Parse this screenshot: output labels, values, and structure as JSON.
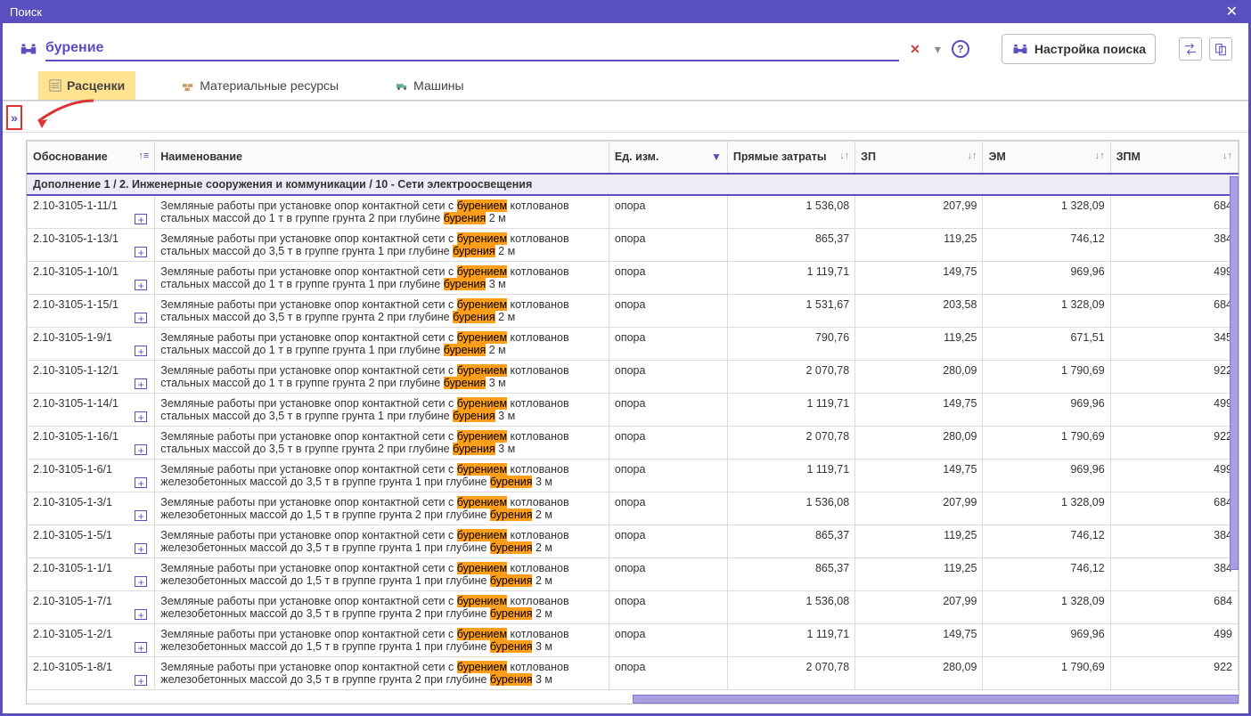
{
  "window": {
    "title": "Поиск"
  },
  "search": {
    "query": "бурение",
    "clear_symbol": "✕",
    "dropdown_symbol": "▾",
    "help_symbol": "?",
    "settings_label": "Настройка поиска"
  },
  "tabs": [
    {
      "label": "Расценки",
      "active": true
    },
    {
      "label": "Материальные ресурсы",
      "active": false
    },
    {
      "label": "Машины",
      "active": false
    }
  ],
  "collapse": {
    "symbol": "»"
  },
  "columns": {
    "code": "Обоснование",
    "name": "Наименование",
    "unit": "Ед. изм.",
    "direct": "Прямые затраты",
    "zp": "ЗП",
    "em": "ЭМ",
    "zpm": "ЗПМ"
  },
  "section": {
    "title": "Дополнение 1 / 2. Инженерные сооружения и коммуникации / 10 - Сети электроосвещения"
  },
  "rows": [
    {
      "code": "2.10-3105-1-11/1",
      "name_pre": "Земляные работы при установке опор контактной сети с ",
      "hl1": "бурением",
      "name_mid": " котлованов стальных массой до 1 т в группе грунта 2 при глубине ",
      "hl2": "бурения",
      "name_post": " 2 м",
      "unit": "опора",
      "direct": "1 536,08",
      "zp": "207,99",
      "em": "1 328,09",
      "zpm": "684"
    },
    {
      "code": "2.10-3105-1-13/1",
      "name_pre": "Земляные работы при установке опор контактной сети с ",
      "hl1": "бурением",
      "name_mid": " котлованов стальных массой до 3,5 т в группе грунта 1 при глубине ",
      "hl2": "бурения",
      "name_post": " 2 м",
      "unit": "опора",
      "direct": "865,37",
      "zp": "119,25",
      "em": "746,12",
      "zpm": "384"
    },
    {
      "code": "2.10-3105-1-10/1",
      "name_pre": "Земляные работы при установке опор контактной сети с ",
      "hl1": "бурением",
      "name_mid": " котлованов стальных массой до 1 т в группе грунта 1 при глубине ",
      "hl2": "бурения",
      "name_post": " 3 м",
      "unit": "опора",
      "direct": "1 119,71",
      "zp": "149,75",
      "em": "969,96",
      "zpm": "499"
    },
    {
      "code": "2.10-3105-1-15/1",
      "name_pre": "Земляные работы при установке опор контактной сети с ",
      "hl1": "бурением",
      "name_mid": " котлованов стальных массой до 3,5 т в группе грунта 2 при глубине ",
      "hl2": "бурения",
      "name_post": " 2 м",
      "unit": "опора",
      "direct": "1 531,67",
      "zp": "203,58",
      "em": "1 328,09",
      "zpm": "684"
    },
    {
      "code": "2.10-3105-1-9/1",
      "name_pre": "Земляные работы при установке опор контактной сети с ",
      "hl1": "бурением",
      "name_mid": " котлованов стальных массой до 1 т в группе грунта 1 при глубине ",
      "hl2": "бурения",
      "name_post": " 2 м",
      "unit": "опора",
      "direct": "790,76",
      "zp": "119,25",
      "em": "671,51",
      "zpm": "345"
    },
    {
      "code": "2.10-3105-1-12/1",
      "name_pre": "Земляные работы при установке опор контактной сети с ",
      "hl1": "бурением",
      "name_mid": " котлованов стальных массой до 1 т в группе грунта 2 при глубине ",
      "hl2": "бурения",
      "name_post": " 3 м",
      "unit": "опора",
      "direct": "2 070,78",
      "zp": "280,09",
      "em": "1 790,69",
      "zpm": "922"
    },
    {
      "code": "2.10-3105-1-14/1",
      "name_pre": "Земляные работы при установке опор контактной сети с ",
      "hl1": "бурением",
      "name_mid": " котлованов стальных массой до 3,5 т в группе грунта 1 при глубине ",
      "hl2": "бурения",
      "name_post": " 3 м",
      "unit": "опора",
      "direct": "1 119,71",
      "zp": "149,75",
      "em": "969,96",
      "zpm": "499"
    },
    {
      "code": "2.10-3105-1-16/1",
      "name_pre": "Земляные работы при установке опор контактной сети с ",
      "hl1": "бурением",
      "name_mid": " котлованов стальных массой до 3,5 т в группе грунта 2 при глубине ",
      "hl2": "бурения",
      "name_post": " 3 м",
      "unit": "опора",
      "direct": "2 070,78",
      "zp": "280,09",
      "em": "1 790,69",
      "zpm": "922"
    },
    {
      "code": "2.10-3105-1-6/1",
      "name_pre": "Земляные работы при установке опор контактной сети с ",
      "hl1": "бурением",
      "name_mid": " котлованов железобетонных массой до 3,5 т в группе грунта 1 при глубине ",
      "hl2": "бурения",
      "name_post": " 3 м",
      "unit": "опора",
      "direct": "1 119,71",
      "zp": "149,75",
      "em": "969,96",
      "zpm": "499"
    },
    {
      "code": "2.10-3105-1-3/1",
      "name_pre": "Земляные работы при установке опор контактной сети с ",
      "hl1": "бурением",
      "name_mid": " котлованов железобетонных массой до 1,5 т в группе грунта 2 при глубине ",
      "hl2": "бурения",
      "name_post": " 2 м",
      "unit": "опора",
      "direct": "1 536,08",
      "zp": "207,99",
      "em": "1 328,09",
      "zpm": "684"
    },
    {
      "code": "2.10-3105-1-5/1",
      "name_pre": "Земляные работы при установке опор контактной сети с ",
      "hl1": "бурением",
      "name_mid": " котлованов железобетонных массой до 3,5 т в группе грунта 1 при глубине ",
      "hl2": "бурения",
      "name_post": " 2 м",
      "unit": "опора",
      "direct": "865,37",
      "zp": "119,25",
      "em": "746,12",
      "zpm": "384"
    },
    {
      "code": "2.10-3105-1-1/1",
      "name_pre": "Земляные работы при установке опор контактной сети с ",
      "hl1": "бурением",
      "name_mid": " котлованов железобетонных массой до 1,5 т в группе грунта 1 при глубине ",
      "hl2": "бурения",
      "name_post": " 2 м",
      "unit": "опора",
      "direct": "865,37",
      "zp": "119,25",
      "em": "746,12",
      "zpm": "384"
    },
    {
      "code": "2.10-3105-1-7/1",
      "name_pre": "Земляные работы при установке опор контактной сети с ",
      "hl1": "бурением",
      "name_mid": " котлованов железобетонных массой до 3,5 т в группе грунта 2 при глубине ",
      "hl2": "бурения",
      "name_post": " 2 м",
      "unit": "опора",
      "direct": "1 536,08",
      "zp": "207,99",
      "em": "1 328,09",
      "zpm": "684"
    },
    {
      "code": "2.10-3105-1-2/1",
      "name_pre": "Земляные работы при установке опор контактной сети с ",
      "hl1": "бурением",
      "name_mid": " котлованов железобетонных массой до 1,5 т в группе грунта 1 при глубине ",
      "hl2": "бурения",
      "name_post": " 3 м",
      "unit": "опора",
      "direct": "1 119,71",
      "zp": "149,75",
      "em": "969,96",
      "zpm": "499"
    },
    {
      "code": "2.10-3105-1-8/1",
      "name_pre": "Земляные работы при установке опор контактной сети с ",
      "hl1": "бурением",
      "name_mid": " котлованов железобетонных массой до 3,5 т в группе грунта 2 при глубине ",
      "hl2": "бурения",
      "name_post": " 3 м",
      "unit": "опора",
      "direct": "2 070,78",
      "zp": "280,09",
      "em": "1 790,69",
      "zpm": "922"
    }
  ]
}
